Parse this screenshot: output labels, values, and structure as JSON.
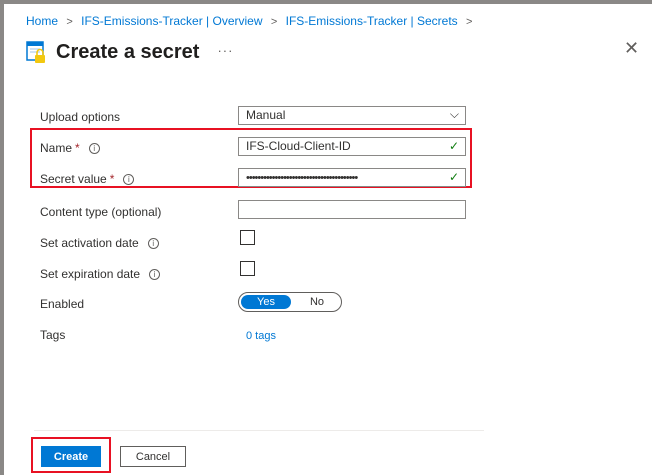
{
  "breadcrumb": {
    "items": [
      "Home",
      "IFS-Emissions-Tracker | Overview",
      "IFS-Emissions-Tracker | Secrets"
    ],
    "separator": ">"
  },
  "header": {
    "title": "Create a secret",
    "more": "···",
    "close": "✕"
  },
  "form": {
    "upload_options": {
      "label": "Upload options",
      "value": "Manual"
    },
    "name": {
      "label": "Name",
      "required": "*",
      "info": "i",
      "value": "IFS-Cloud-Client-ID"
    },
    "secret_value": {
      "label": "Secret value",
      "required": "*",
      "info": "i",
      "value": "•••••••••••••••••••••••••••••••••••••••"
    },
    "content_type": {
      "label": "Content type (optional)",
      "value": ""
    },
    "activation_date": {
      "label": "Set activation date",
      "info": "i",
      "checked": false
    },
    "expiration_date": {
      "label": "Set expiration date",
      "info": "i",
      "checked": false
    },
    "enabled": {
      "label": "Enabled",
      "yes": "Yes",
      "no": "No",
      "selected": "Yes"
    },
    "tags": {
      "label": "Tags",
      "link": "0 tags"
    }
  },
  "footer": {
    "create_label": "Create",
    "cancel_label": "Cancel"
  },
  "colors": {
    "accent": "#0078d4",
    "highlight_border": "#e81123",
    "valid_check": "#107c10"
  },
  "icons": {
    "title_icon": "key-vault-secret-icon",
    "more": "more-icon",
    "close": "close-icon",
    "dropdown": "chevron-down-icon",
    "valid": "checkmark-icon",
    "info": "info-icon"
  }
}
